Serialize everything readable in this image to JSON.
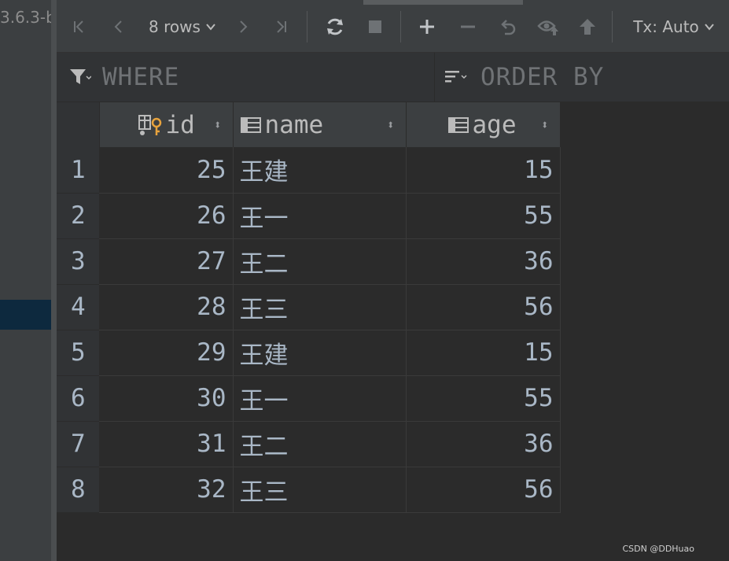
{
  "sidebar": {
    "crumb": "3.6.3-b"
  },
  "toolbar": {
    "rows_label": "8 rows",
    "tx_label": "Tx: Auto"
  },
  "filter": {
    "where_label": "WHERE",
    "order_label": "ORDER BY"
  },
  "table": {
    "columns": [
      {
        "label": "id",
        "icon": "primary-key-column-icon"
      },
      {
        "label": "name",
        "icon": "column-icon"
      },
      {
        "label": "age",
        "icon": "column-icon"
      }
    ],
    "rows": [
      {
        "num": "1",
        "id": "25",
        "name": "王建",
        "age": "15"
      },
      {
        "num": "2",
        "id": "26",
        "name": "王一",
        "age": "55"
      },
      {
        "num": "3",
        "id": "27",
        "name": "王二",
        "age": "36"
      },
      {
        "num": "4",
        "id": "28",
        "name": "王三",
        "age": "56"
      },
      {
        "num": "5",
        "id": "29",
        "name": "王建",
        "age": "15"
      },
      {
        "num": "6",
        "id": "30",
        "name": "王一",
        "age": "55"
      },
      {
        "num": "7",
        "id": "31",
        "name": "王二",
        "age": "36"
      },
      {
        "num": "8",
        "id": "32",
        "name": "王三",
        "age": "56"
      }
    ]
  },
  "watermark": "CSDN @DDHuao",
  "colors": {
    "background": "#2b2b2b",
    "panel": "#3c3f41",
    "key_icon": "#e8a33d"
  }
}
